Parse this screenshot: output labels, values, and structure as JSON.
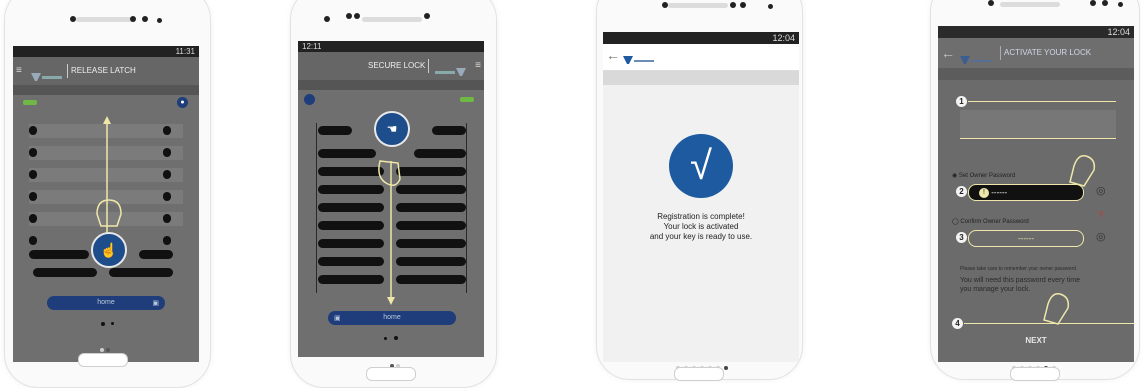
{
  "phone1": {
    "time": "11:31",
    "title": "RELEASE LATCH",
    "field": "home"
  },
  "phone2": {
    "time": "12:11",
    "title": "SECURE LOCK",
    "field": "home"
  },
  "phone3": {
    "time": "12:04",
    "message": [
      "Registration is complete!",
      "Your lock is activated",
      "and your key is ready to use."
    ]
  },
  "phone4": {
    "time": "12:04",
    "title": "ACTIVATE YOUR LOCK",
    "set_label": "Set Owner Password",
    "confirm_label": "Confirm Owner Password",
    "pw_dots": "------",
    "hint_small": "Please take care to remember your owner password",
    "hint_line1": "You will need this password every time",
    "hint_line2": "you manage your lock.",
    "next": "NEXT",
    "steps": [
      "1",
      "2",
      "3",
      "4"
    ],
    "question": "?"
  }
}
